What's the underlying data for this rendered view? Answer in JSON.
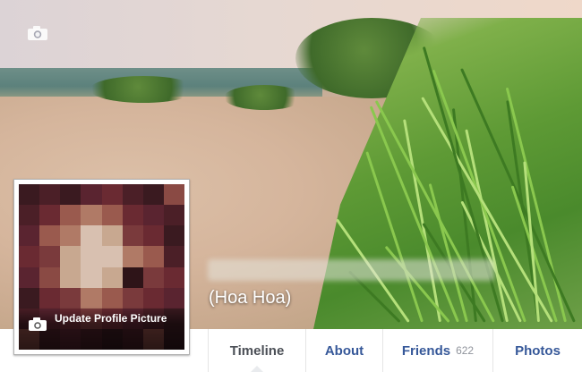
{
  "profile": {
    "name": "(Hoa Hoa)",
    "update_picture_label": "Update Profile Picture"
  },
  "cover": {
    "camera_icon": "camera-icon"
  },
  "tabs": [
    {
      "label": "Timeline",
      "active": true
    },
    {
      "label": "About"
    },
    {
      "label": "Friends",
      "count": "622"
    },
    {
      "label": "Photos"
    }
  ],
  "colors": {
    "link": "#365899",
    "active_tab": "#4b4f56",
    "count": "#90949c"
  }
}
